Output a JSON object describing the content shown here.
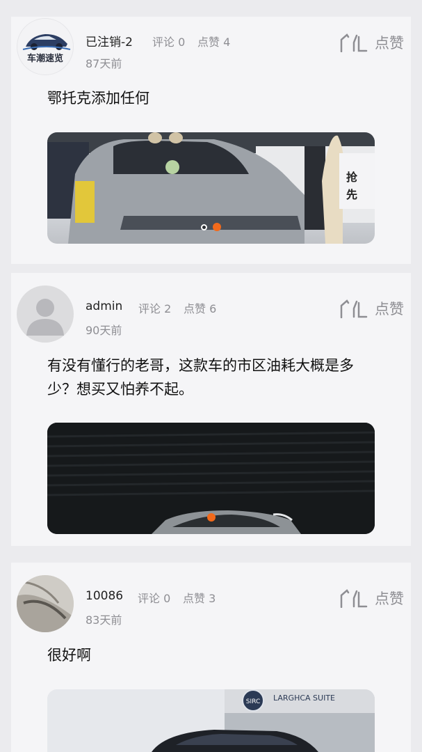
{
  "posts": [
    {
      "avatar_label": "车潮速览",
      "username": "已注销-2",
      "comments": "评论 0",
      "likes": "点赞 4",
      "time": "87天前",
      "like_label": "点赞",
      "text": "鄂托克添加任何",
      "image_desc_icon": "car-show-photo"
    },
    {
      "username": "admin",
      "comments": "评论 2",
      "likes": "点赞 6",
      "time": "90天前",
      "like_label": "点赞",
      "text": "有没有懂行的老哥，这款车的市区油耗大概是多少？想买又怕养不起。",
      "image_desc_icon": "car-dark-photo"
    },
    {
      "username": "10086",
      "comments": "评论 0",
      "likes": "点赞 3",
      "time": "83天前",
      "like_label": "点赞",
      "text": "很好啊",
      "image_sign_text": "LARGHCA SUITE",
      "image_logo_text": "SIRC",
      "image_desc_icon": "car-building-photo"
    }
  ],
  "colors": {
    "accent_orange": "#f26a1b",
    "meta_gray": "#8e8e93",
    "card_bg": "#f5f5f7"
  }
}
